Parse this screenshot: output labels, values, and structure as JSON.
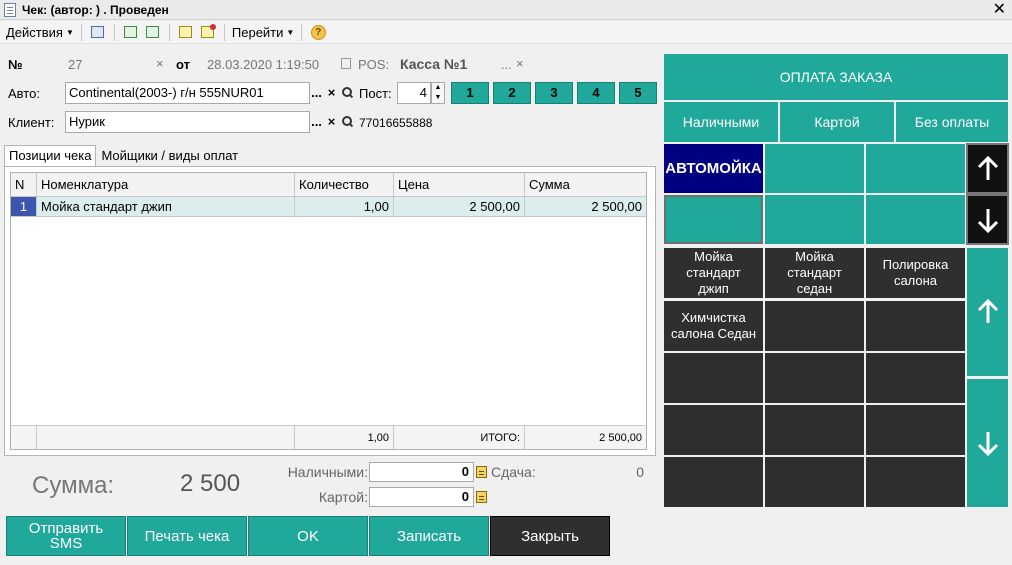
{
  "window": {
    "title": "Чек:  (автор: ) . Проведен"
  },
  "toolbar": {
    "actions_label": "Действия",
    "goto_label": "Перейти",
    "help_glyph": "?"
  },
  "header": {
    "number_label": "№",
    "number_value": "27",
    "clear_glyph": "×",
    "from_label": "от",
    "date_value": "28.03.2020  1:19:50",
    "pos_label": "POS:",
    "pos_value": "Касса №1",
    "dots": "...",
    "auto_label": "Авто:",
    "auto_value": "Continental(2003-) г/н 555NUR01",
    "post_label": "Пост:",
    "post_value": "4",
    "client_label": "Клиент:",
    "client_value": "Нурик",
    "client_phone": "77016655888",
    "post_buttons": [
      "1",
      "2",
      "3",
      "4",
      "5"
    ]
  },
  "tabs": {
    "positions": "Позиции чека",
    "washers": "Мойщики / виды оплат"
  },
  "table": {
    "columns": {
      "n": "N",
      "name": "Номенклатура",
      "qty": "Количество",
      "price": "Цена",
      "sum": "Сумма"
    },
    "rows": [
      {
        "n": "1",
        "name": "Мойка стандарт джип",
        "qty": "1,00",
        "price": "2 500,00",
        "sum": "2 500,00"
      }
    ],
    "footer": {
      "qty": "1,00",
      "total_label": "ИТОГО:",
      "sum": "2 500,00"
    }
  },
  "totals": {
    "sum_label": "Сумма:",
    "sum_value": "2 500",
    "cash_label": "Наличными:",
    "cash_value": "0",
    "card_label": "Картой:",
    "card_value": "0",
    "change_label": "Сдача:",
    "change_value": "0"
  },
  "buttons": {
    "sms_line1": "Отправить",
    "sms_line2": "SMS",
    "print": "Печать чека",
    "ok": "OK",
    "save": "Записать",
    "close": "Закрыть"
  },
  "right_panel": {
    "pay_title": "ОПЛАТА ЗАКАЗА",
    "pay_cash": "Наличными",
    "pay_card": "Картой",
    "pay_none": "Без оплаты",
    "category": "АВТОМОЙКА",
    "products": [
      {
        "l1": "Мойка",
        "l2": "стандарт",
        "l3": "джип"
      },
      {
        "l1": "Мойка",
        "l2": "стандарт",
        "l3": "седан"
      },
      {
        "l1": "Полировка",
        "l2": "салона",
        "l3": ""
      },
      {
        "l1": "Химчистка",
        "l2": "салона Седан",
        "l3": ""
      }
    ]
  },
  "colors": {
    "accent": "#20a89a",
    "dark_tile": "#2f2f2f",
    "category": "#000080",
    "row_highlight": "#dbeeed"
  }
}
